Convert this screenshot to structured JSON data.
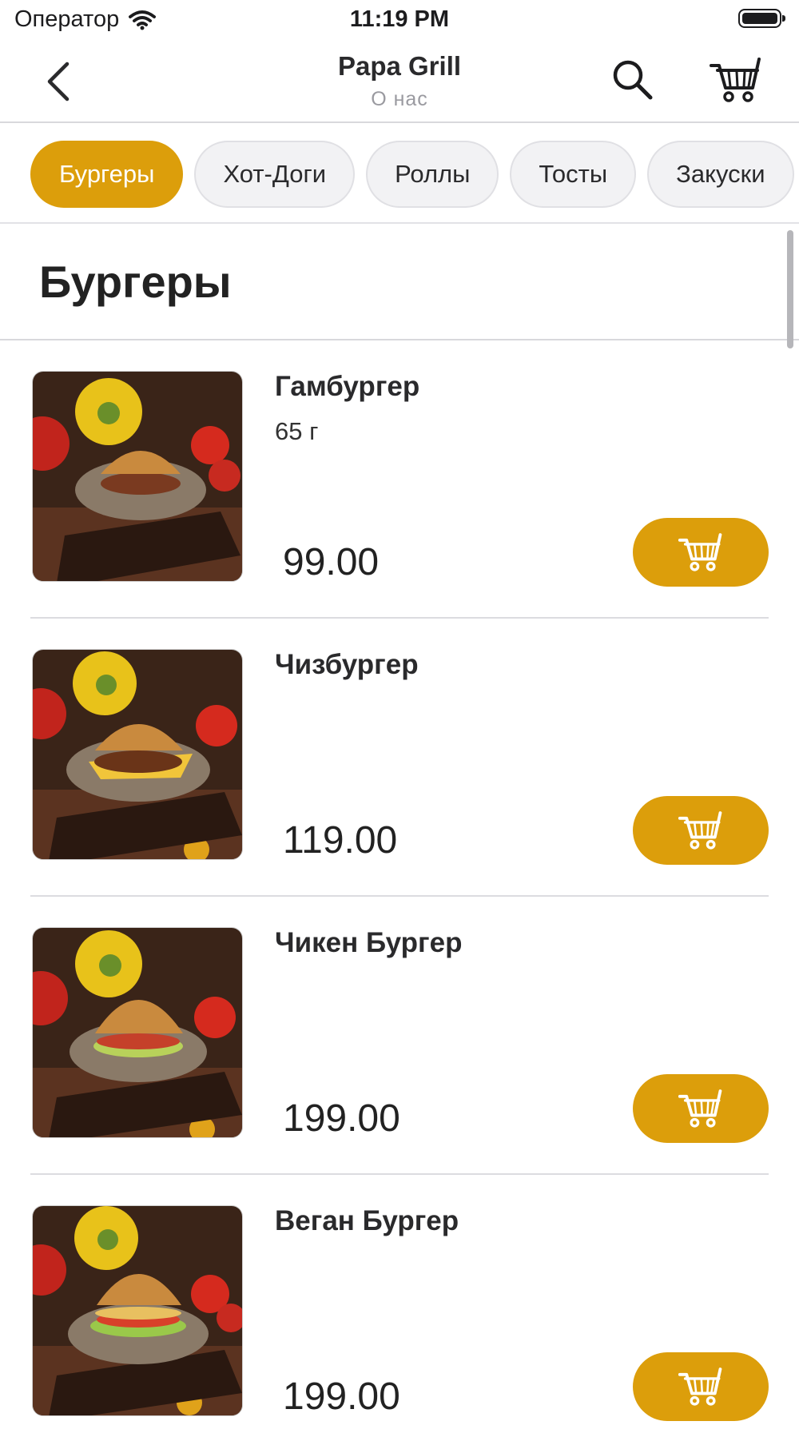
{
  "status_bar": {
    "carrier": "Оператор",
    "time": "11:19 PM"
  },
  "nav": {
    "title": "Papa Grill",
    "subtitle": "О нас",
    "icons": {
      "back": "chevron-left-icon",
      "search": "search-icon",
      "cart": "cart-icon"
    }
  },
  "categories": [
    {
      "label": "Бургеры",
      "active": true
    },
    {
      "label": "Хот-Доги",
      "active": false
    },
    {
      "label": "Роллы",
      "active": false
    },
    {
      "label": "Тосты",
      "active": false
    },
    {
      "label": "Закуски",
      "active": false
    }
  ],
  "section": {
    "title": "Бургеры"
  },
  "products": [
    {
      "name": "Гамбургер",
      "weight": "65 г",
      "price": "99.00"
    },
    {
      "name": "Чизбургер",
      "weight": "",
      "price": "119.00"
    },
    {
      "name": "Чикен Бургер",
      "weight": "",
      "price": "199.00"
    },
    {
      "name": "Веган Бургер",
      "weight": "",
      "price": "199.00"
    }
  ],
  "colors": {
    "accent": "#dc9e0b",
    "separator": "#dcdce0",
    "chip_bg": "#f2f2f4"
  }
}
